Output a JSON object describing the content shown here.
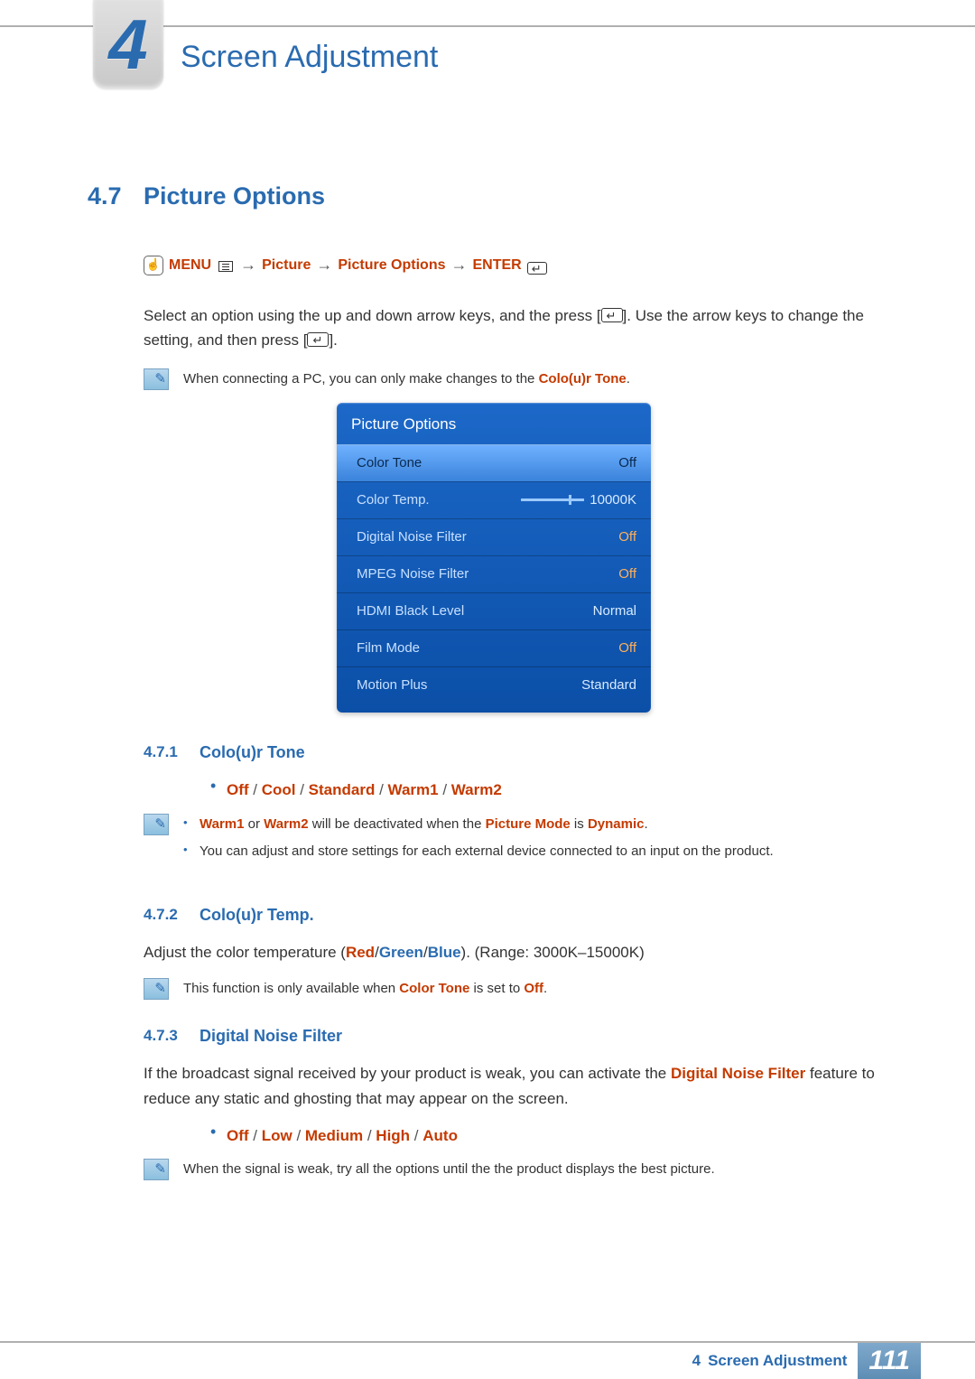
{
  "chapter": {
    "number": "4",
    "title": "Screen Adjustment"
  },
  "section": {
    "number": "4.7",
    "title": "Picture Options"
  },
  "breadcrumb": {
    "menu": "MENU",
    "p1": "Picture",
    "p2": "Picture Options",
    "enter": "ENTER"
  },
  "intro": {
    "t1": "Select an option using the up and down arrow keys, and the press [",
    "t2": "]. Use the arrow keys to change the setting, and then press [",
    "t3": "]."
  },
  "note1": {
    "pre": "When connecting a PC, you can only make changes to the ",
    "hl": "Colo(u)r Tone",
    "post": "."
  },
  "osd": {
    "title": "Picture Options",
    "rows": [
      {
        "label": "Color Tone",
        "value": "Off",
        "selected": true
      },
      {
        "label": "Color Temp.",
        "value": "10000K",
        "slider": true
      },
      {
        "label": "Digital Noise Filter",
        "value": "Off",
        "orange": true
      },
      {
        "label": "MPEG Noise Filter",
        "value": "Off",
        "orange": true
      },
      {
        "label": "HDMI Black Level",
        "value": "Normal"
      },
      {
        "label": "Film Mode",
        "value": "Off",
        "orange": true
      },
      {
        "label": "Motion Plus",
        "value": "Standard"
      }
    ]
  },
  "sub471": {
    "num": "4.7.1",
    "title": "Colo(u)r Tone",
    "opts": [
      "Off",
      "Cool",
      "Standard",
      "Warm1",
      "Warm2"
    ],
    "note": {
      "b1a": "Warm1",
      "b1b": " or ",
      "b1c": "Warm2",
      "b1d": " will be deactivated when the ",
      "b1e": "Picture Mode",
      "b1f": " is ",
      "b1g": "Dynamic",
      "b1h": ".",
      "b2": "You can adjust and store settings for each external device connected to an input on the product."
    }
  },
  "sub472": {
    "num": "4.7.2",
    "title": "Colo(u)r Temp.",
    "body": {
      "t1": "Adjust the color temperature (",
      "r": "Red",
      "s1": "/",
      "g": "Green",
      "s2": "/",
      "b": "Blue",
      "t2": "). (Range: 3000K–15000K)"
    },
    "note": {
      "t1": "This function is only available when ",
      "hl": "Color Tone",
      "t2": " is set to ",
      "hl2": "Off",
      "t3": "."
    }
  },
  "sub473": {
    "num": "4.7.3",
    "title": "Digital Noise Filter",
    "body": {
      "t1": "If the broadcast signal received by your product is weak, you can activate the ",
      "hl": "Digital Noise Filter",
      "t2": " feature to reduce any static and ghosting that may appear on the screen."
    },
    "opts": [
      "Off",
      "Low",
      "Medium",
      "High",
      "Auto"
    ],
    "note": "When the signal is weak, try all the options until the the product displays the best picture."
  },
  "footer": {
    "chap": "4",
    "title": "Screen Adjustment",
    "page": "111"
  }
}
